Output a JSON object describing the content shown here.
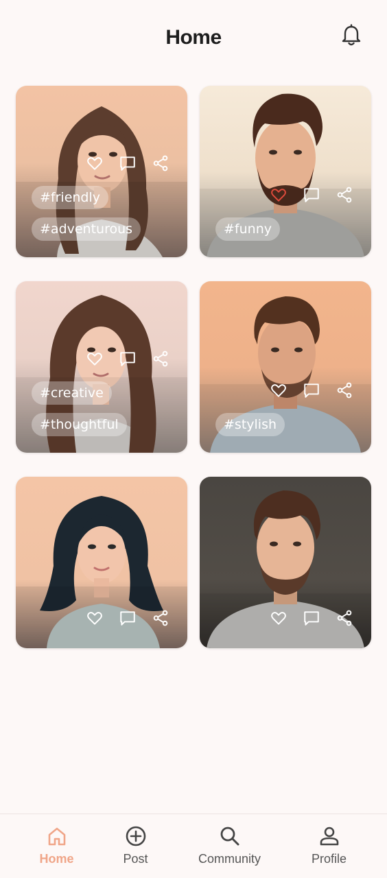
{
  "header": {
    "title": "Home",
    "bell_icon": "bell-icon"
  },
  "cards": [
    {
      "tags": [
        "#friendly",
        "#adventurous"
      ],
      "liked": false
    },
    {
      "tags": [
        "#funny"
      ],
      "liked": true
    },
    {
      "tags": [
        "#creative",
        "#thoughtful"
      ],
      "liked": false
    },
    {
      "tags": [
        "#stylish"
      ],
      "liked": false
    },
    {
      "tags": [],
      "liked": false
    },
    {
      "tags": [],
      "liked": false
    }
  ],
  "nav": {
    "items": [
      {
        "label": "Home",
        "icon": "home-icon",
        "active": true
      },
      {
        "label": "Post",
        "icon": "plus-circle-icon",
        "active": false
      },
      {
        "label": "Community",
        "icon": "search-icon",
        "active": false
      },
      {
        "label": "Profile",
        "icon": "person-icon",
        "active": false
      }
    ]
  },
  "colors": {
    "accent": "#f0a588",
    "like_active": "#e04b3c",
    "background": "#fdf8f7"
  }
}
